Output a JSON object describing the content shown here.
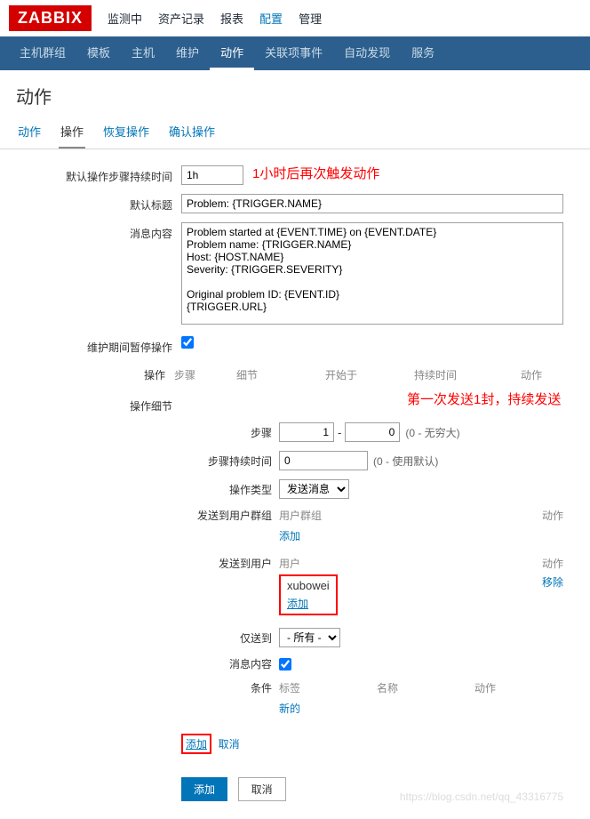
{
  "logo": "ZABBIX",
  "top_nav": [
    "监测中",
    "资产记录",
    "报表",
    "配置",
    "管理"
  ],
  "top_nav_active": 3,
  "sub_nav": [
    "主机群组",
    "模板",
    "主机",
    "维护",
    "动作",
    "关联项事件",
    "自动发现",
    "服务"
  ],
  "sub_nav_active": 4,
  "page_title": "动作",
  "tabs": [
    "动作",
    "操作",
    "恢复操作",
    "确认操作"
  ],
  "tabs_active": 1,
  "form": {
    "default_step_duration_label": "默认操作步骤持续时间",
    "default_step_duration_value": "1h",
    "default_step_duration_annot": "1小时后再次触发动作",
    "default_title_label": "默认标题",
    "default_title_value": "Problem: {TRIGGER.NAME}",
    "message_label": "消息内容",
    "message_value": "Problem started at {EVENT.TIME} on {EVENT.DATE}\nProblem name: {TRIGGER.NAME}\nHost: {HOST.NAME}\nSeverity: {TRIGGER.SEVERITY}\n\nOriginal problem ID: {EVENT.ID}\n{TRIGGER.URL}",
    "pause_maint_label": "维护期间暂停操作",
    "pause_maint_checked": true,
    "ops_label": "操作",
    "ops_headers": [
      "步骤",
      "细节",
      "开始于",
      "持续时间",
      "动作"
    ],
    "detail_label": "操作细节",
    "detail_annot": "第一次发送1封，持续发送",
    "step_label": "步骤",
    "step_from": "1",
    "step_to": "0",
    "step_hint": "(0 - 无穷大)",
    "step_dur_label": "步骤持续时间",
    "step_dur_value": "0",
    "step_dur_hint": "(0 - 使用默认)",
    "op_type_label": "操作类型",
    "op_type_value": "发送消息",
    "send_group_label": "发送到用户群组",
    "send_group_headers": [
      "用户群组",
      "动作"
    ],
    "send_group_add": "添加",
    "send_user_label": "发送到用户",
    "send_user_headers": [
      "用户",
      "动作"
    ],
    "send_user_rows": [
      {
        "name": "xubowei",
        "action": "移除"
      }
    ],
    "send_user_add": "添加",
    "send_only_label": "仅送到",
    "send_only_value": "- 所有 -",
    "msg_content_label": "消息内容",
    "msg_content_checked": true,
    "cond_label": "条件",
    "cond_headers": [
      "标签",
      "名称",
      "动作"
    ],
    "cond_new": "新的",
    "bottom_add": "添加",
    "bottom_cancel": "取消",
    "final_add": "添加",
    "final_cancel": "取消"
  },
  "watermark": "https://blog.csdn.net/qq_43316775"
}
